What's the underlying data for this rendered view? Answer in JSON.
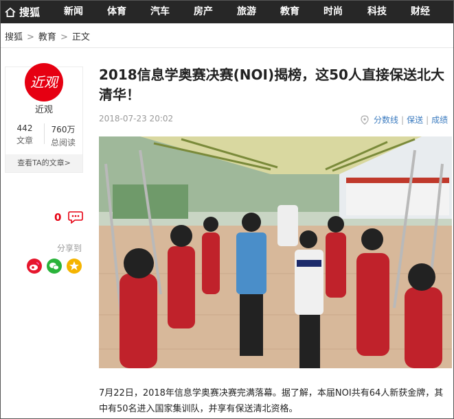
{
  "nav": {
    "home_label": "搜狐",
    "items": [
      "新闻",
      "体育",
      "汽车",
      "房产",
      "旅游",
      "教育",
      "时尚",
      "科技",
      "财经"
    ]
  },
  "breadcrumb": [
    "搜狐",
    "教育",
    "正文"
  ],
  "author": {
    "avatar_text": "近观",
    "name": "近观",
    "articles_count": "442",
    "articles_label": "文章",
    "reads_count": "760万",
    "reads_label": "总阅读",
    "view_all_label": "查看TA的文章>"
  },
  "sidebar": {
    "comment_count": "0",
    "share_label": "分享到"
  },
  "article": {
    "title": "2018信息学奥赛决赛(NOI)揭榜，这50人直接保送北大清华！",
    "date": "2018-07-23 20:02",
    "tags": [
      "分数线",
      "保送",
      "成绩"
    ],
    "paragraph": "7月22日，2018年信息学奥赛决赛完满落幕。据了解，本届NOI共有64人新获金牌，其中有50名进入国家集训队，并享有保送清北资格。"
  },
  "colors": {
    "nav_bg": "#272727",
    "brand_red": "#e60012",
    "link_blue": "#3b7bbf"
  }
}
